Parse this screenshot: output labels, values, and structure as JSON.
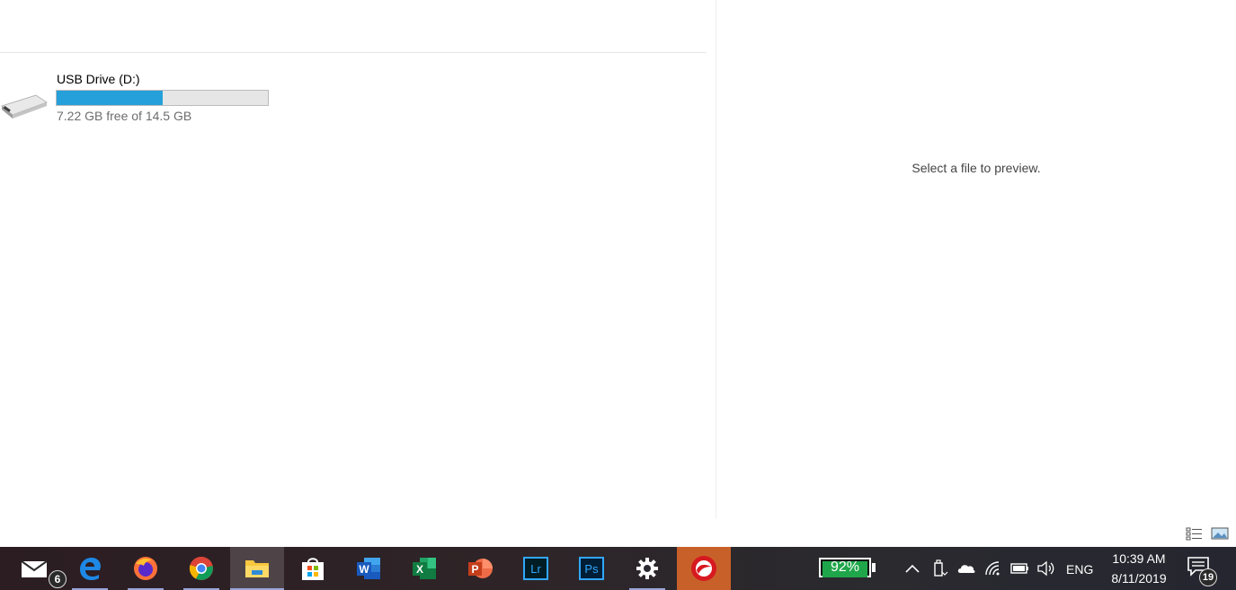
{
  "drive": {
    "name": "USB Drive (D:)",
    "free_text": "7.22 GB free of 14.5 GB",
    "used_fraction": 0.502
  },
  "preview": {
    "message": "Select a file to preview."
  },
  "view_buttons": [
    "details-view-icon",
    "large-icons-view-icon"
  ],
  "taskbar": {
    "apps": [
      {
        "name": "mail",
        "icon": "mail-icon"
      },
      {
        "name": "edge",
        "icon": "edge-icon"
      },
      {
        "name": "firefox",
        "icon": "firefox-icon"
      },
      {
        "name": "chrome",
        "icon": "chrome-icon"
      },
      {
        "name": "file-explorer",
        "icon": "folder-icon"
      },
      {
        "name": "store",
        "icon": "store-icon"
      },
      {
        "name": "word",
        "icon": "word-icon",
        "letter": "W"
      },
      {
        "name": "excel",
        "icon": "excel-icon",
        "letter": "X"
      },
      {
        "name": "powerpoint",
        "icon": "powerpoint-icon",
        "letter": "P"
      },
      {
        "name": "lightroom",
        "icon": "lightroom-icon",
        "letter": "Lr"
      },
      {
        "name": "photoshop",
        "icon": "photoshop-icon",
        "letter": "Ps"
      },
      {
        "name": "settings",
        "icon": "gear-icon"
      },
      {
        "name": "trend-micro",
        "icon": "trend-micro-icon"
      }
    ],
    "mail_badge": "6",
    "battery_percent": "92%",
    "battery_level": 0.92,
    "language": "ENG",
    "time": "10:39 AM",
    "date": "8/11/2019",
    "notification_count": "19"
  },
  "colors": {
    "progress_fill": "#26a0da",
    "battery_fill": "#1fa64a",
    "trend_bg": "#c8602a"
  }
}
